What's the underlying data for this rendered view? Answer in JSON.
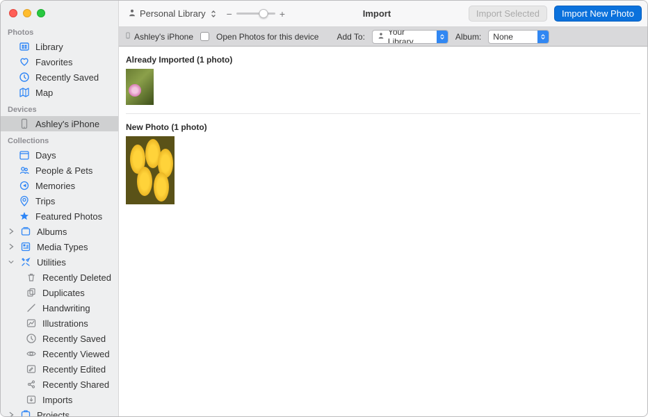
{
  "toolbar": {
    "library_picker_label": "Personal Library",
    "title": "Import",
    "import_selected_label": "Import Selected",
    "import_new_label": "Import New Photo",
    "zoom_minus": "−",
    "zoom_plus": "+"
  },
  "subbar": {
    "device_name": "Ashley's iPhone",
    "open_photos_label": "Open Photos for this device",
    "open_photos_checked": false,
    "add_to_label": "Add To:",
    "add_to_selected": "Your Library",
    "album_label": "Album:",
    "album_selected": "None"
  },
  "sections": {
    "already": {
      "title": "Already Imported (1 photo)"
    },
    "new": {
      "title": "New Photo (1 photo)"
    }
  },
  "sidebar": {
    "section_photos": "Photos",
    "library": "Library",
    "favorites": "Favorites",
    "recently_saved": "Recently Saved",
    "map": "Map",
    "section_devices": "Devices",
    "device_item": "Ashley's iPhone",
    "section_collections": "Collections",
    "days": "Days",
    "people_pets": "People & Pets",
    "memories": "Memories",
    "trips": "Trips",
    "featured": "Featured Photos",
    "albums": "Albums",
    "media_types": "Media Types",
    "utilities": "Utilities",
    "utilities_children": {
      "recently_deleted": "Recently Deleted",
      "duplicates": "Duplicates",
      "handwriting": "Handwriting",
      "illustrations": "Illustrations",
      "recently_saved": "Recently Saved",
      "recently_viewed": "Recently Viewed",
      "recently_edited": "Recently Edited",
      "recently_shared": "Recently Shared",
      "imports": "Imports"
    },
    "projects": "Projects"
  }
}
